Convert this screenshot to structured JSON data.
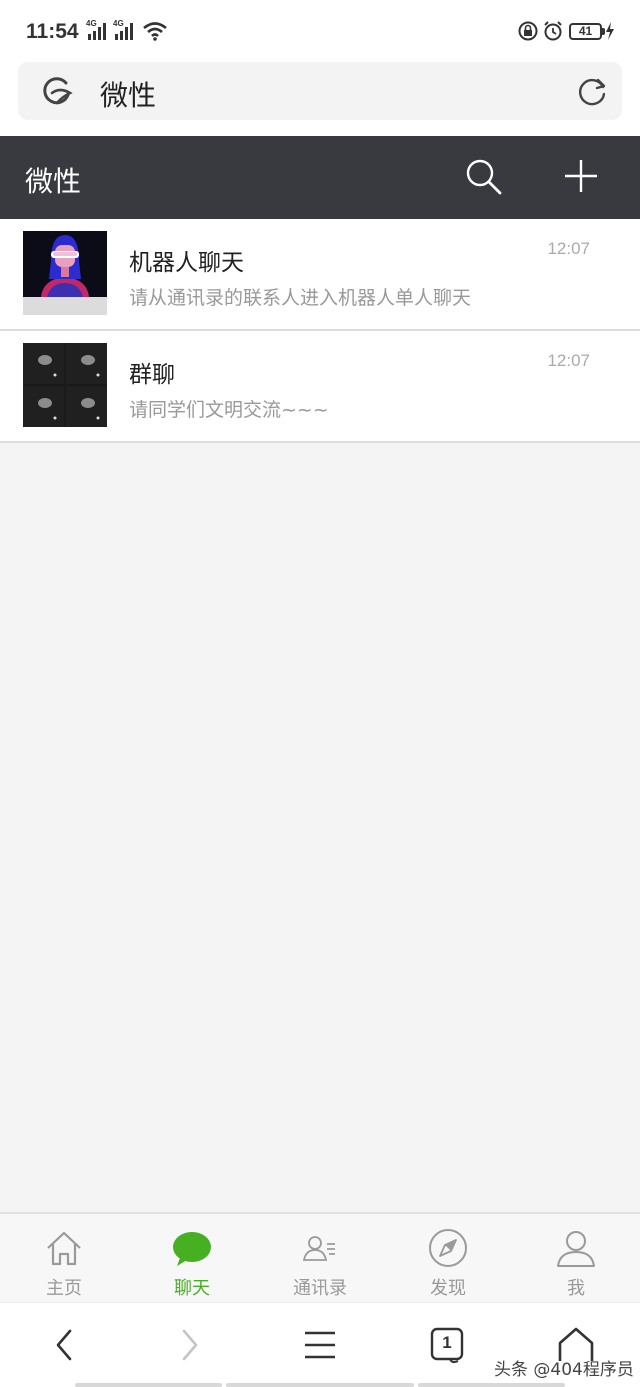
{
  "status_bar": {
    "time": "11:54",
    "network_1": "4G",
    "network_2": "4G",
    "battery": "41"
  },
  "browser": {
    "url_text": "微性"
  },
  "app": {
    "title": "微性"
  },
  "chats": [
    {
      "name": "机器人聊天",
      "preview": "请从通讯录的联系人进入机器人单人聊天",
      "time": "12:07"
    },
    {
      "name": "群聊",
      "preview": "请同学们文明交流~~~",
      "time": "12:07"
    }
  ],
  "tabs": [
    {
      "label": "主页",
      "icon": "home-icon"
    },
    {
      "label": "聊天",
      "icon": "chat-icon",
      "active": true
    },
    {
      "label": "通讯录",
      "icon": "contacts-icon"
    },
    {
      "label": "发现",
      "icon": "compass-icon"
    },
    {
      "label": "我",
      "icon": "user-icon"
    }
  ],
  "nav": {
    "tab_count": "1",
    "watermark": "头条 @404程序员"
  },
  "colors": {
    "header_bg": "#393a3f",
    "active_tab": "#46b022",
    "background": "#f4f4f4"
  }
}
